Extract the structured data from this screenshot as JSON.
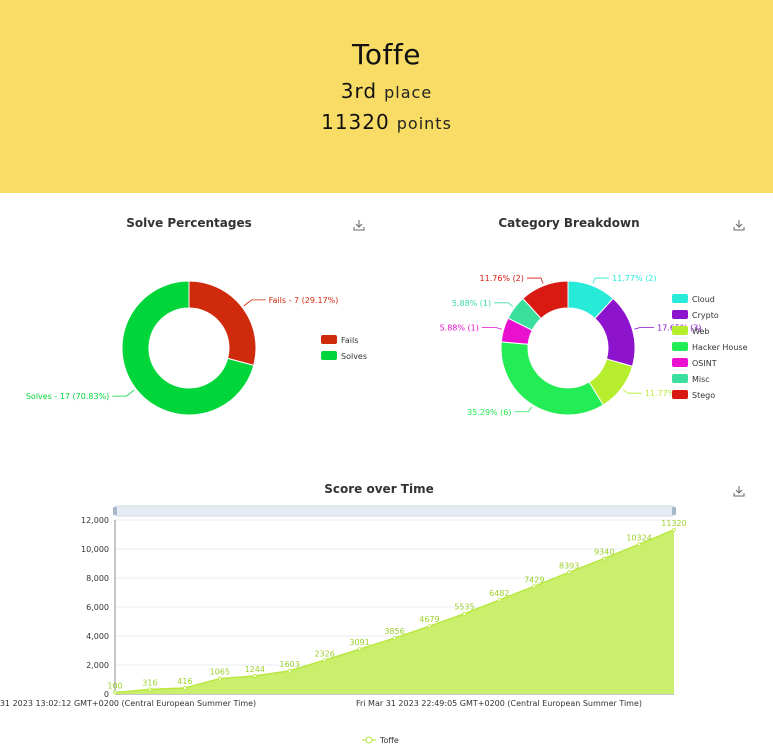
{
  "header": {
    "team_name": "Toffe",
    "place_number": "3rd",
    "place_word": "place",
    "points_number": "11320",
    "points_word": "points"
  },
  "solve_percentages": {
    "title": "Solve Percentages",
    "download_icon": "download-icon",
    "chart_data": {
      "type": "pie",
      "slices": [
        {
          "name": "Fails",
          "value": 7,
          "percent": "29.17%",
          "label": "Fails - 7 (29.17%)",
          "color": "#cf2a0c"
        },
        {
          "name": "Solves",
          "value": 17,
          "percent": "70.83%",
          "label": "Solves - 17 (70.83%)",
          "color": "#00d639"
        }
      ],
      "legend": [
        "Fails",
        "Solves"
      ],
      "legend_position": "right"
    }
  },
  "category_breakdown": {
    "title": "Category Breakdown",
    "download_icon": "download-icon",
    "chart_data": {
      "type": "pie",
      "slices": [
        {
          "name": "Cloud",
          "value": 2,
          "label": "11.77% (2)",
          "color": "#27ead8"
        },
        {
          "name": "Crypto",
          "value": 3,
          "label": "17.65% (3)",
          "color": "#8e13cc"
        },
        {
          "name": "Web",
          "value": 2,
          "label": "11.77%",
          "color": "#b6ee2e"
        },
        {
          "name": "Hacker House",
          "value": 6,
          "label": "35.29% (6)",
          "color": "#24ec55"
        },
        {
          "name": "OSINT",
          "value": 1,
          "label": "5.88% (1)",
          "color": "#ea10d0"
        },
        {
          "name": "Misc",
          "value": 1,
          "label": "5.88% (1)",
          "color": "#3bdf9d"
        },
        {
          "name": "Stego",
          "value": 2,
          "label": "11.76% (2)",
          "color": "#d81a12"
        }
      ],
      "legend": [
        "Cloud",
        "Crypto",
        "Web",
        "Hacker House",
        "OSINT",
        "Misc",
        "Stego"
      ],
      "legend_position": "right"
    }
  },
  "score_over_time": {
    "title": "Score over Time",
    "download_icon": "download-icon",
    "chart_data": {
      "type": "area",
      "x_labels": [
        "31 2023 13:02:12 GMT+0200 (Central European Summer Time)",
        "Fri Mar 31 2023 22:49:05 GMT+0200 (Central European Summer Time)"
      ],
      "series": [
        {
          "name": "Toffe",
          "color": "#b9e840",
          "values": [
            100,
            316,
            416,
            1065,
            1244,
            1603,
            2326,
            3091,
            3856,
            4679,
            5535,
            6482,
            7429,
            8393,
            9340,
            10324,
            11320
          ]
        }
      ],
      "ylim": [
        0,
        12000
      ],
      "y_ticks": [
        "0",
        "2,000",
        "4,000",
        "6,000",
        "8,000",
        "10,000",
        "12,000"
      ],
      "legend": [
        "Toffe"
      ],
      "legend_position": "bottom"
    }
  }
}
